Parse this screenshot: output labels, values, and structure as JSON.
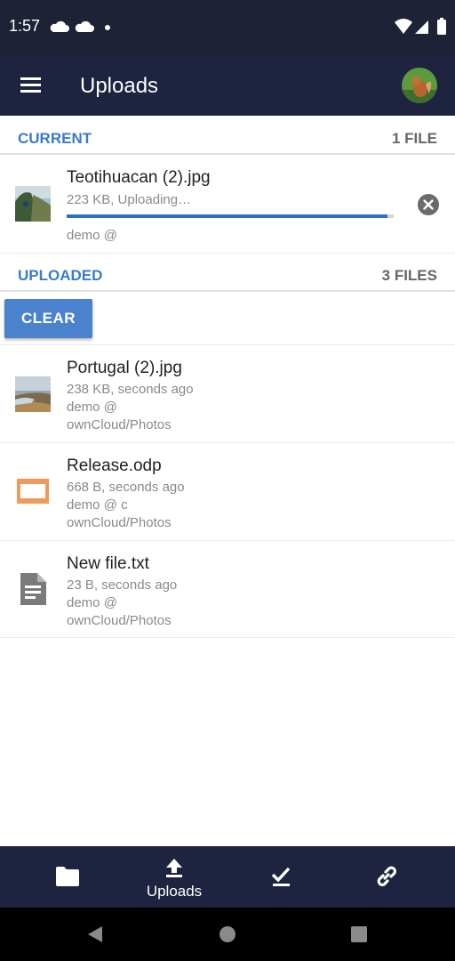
{
  "status_bar": {
    "time": "1:57"
  },
  "app_bar": {
    "title": "Uploads",
    "menu_icon": "hamburger-menu-icon",
    "avatar_icon": "user-avatar"
  },
  "current": {
    "header_label": "CURRENT",
    "count_label": "1 FILE",
    "items": [
      {
        "filename": "Teotihuacan (2).jpg",
        "status": "223 KB, Uploading…",
        "account": "demo @",
        "progress": 0.98,
        "cancel_icon": "cancel-upload-icon"
      }
    ]
  },
  "uploaded": {
    "header_label": "UPLOADED",
    "count_label": "3 FILES",
    "clear_label": "CLEAR",
    "items": [
      {
        "filename": "Portugal (2).jpg",
        "status": "238 KB,  seconds ago",
        "account": "demo @",
        "path": "ownCloud/Photos",
        "icon": "image-thumbnail"
      },
      {
        "filename": "Release.odp",
        "status": "668 B,  seconds ago",
        "account": "demo @ c",
        "path": "ownCloud/Photos",
        "icon": "presentation-file-icon"
      },
      {
        "filename": "New file.txt",
        "status": "23 B,  seconds ago",
        "account": "demo @",
        "path": "ownCloud/Photos",
        "icon": "text-file-icon"
      }
    ]
  },
  "bottom_nav": {
    "items": [
      {
        "icon": "folder-icon",
        "label": ""
      },
      {
        "icon": "upload-icon",
        "label": "Uploads"
      },
      {
        "icon": "checklist-icon",
        "label": ""
      },
      {
        "icon": "link-icon",
        "label": ""
      }
    ]
  },
  "colors": {
    "primary": "#1e2340",
    "accent": "#3b7ac9",
    "button": "#4a82cd",
    "progress": "#2f6fc4"
  }
}
